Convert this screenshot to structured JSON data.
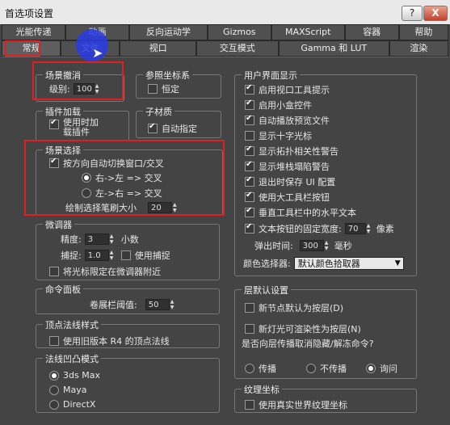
{
  "window": {
    "title": "首选项设置",
    "help_glyph": "?",
    "close_glyph": "X"
  },
  "tabs_row1": [
    "光能传递",
    "动画",
    "反向运动学",
    "Gizmos",
    "MAXScript",
    "容器",
    "帮助"
  ],
  "tabs_row2": [
    "常规",
    "文件",
    "视口",
    "交互模式",
    "Gamma 和 LUT",
    "渲染"
  ],
  "scene_undo": {
    "title": "场景撤消",
    "levels_label": "级别:",
    "levels_value": "100"
  },
  "ref_coord": {
    "title": "参照坐标系",
    "constant_label": "恒定"
  },
  "plugin_load": {
    "title": "插件加载",
    "load_line1": "使用时加",
    "load_line2": "载插件"
  },
  "sub_material": {
    "title": "子材质",
    "auto_assign": "自动指定"
  },
  "scene_select": {
    "title": "场景选择",
    "auto_switch": "按方向自动切换窗口/交叉",
    "rtl": "右->左 => 交叉",
    "ltr": "左->右 => 交叉",
    "brush_size_label": "绘制选择笔刷大小",
    "brush_size_value": "20"
  },
  "spinners": {
    "title": "微调器",
    "precision_label": "精度:",
    "precision_value": "3",
    "precision_unit": "小数",
    "snap_label": "捕捉:",
    "snap_value": "1.0",
    "use_snap": "使用捕捉",
    "wrap_cursor": "将光标限定在微调器附近"
  },
  "command_panel": {
    "title": "命令面板",
    "rollout_label": "卷展栏阈值:",
    "rollout_value": "50"
  },
  "vertex_normal": {
    "title": "顶点法线样式",
    "legacy": "使用旧版本 R4 的顶点法线"
  },
  "bump_mode": {
    "title": "法线凹凸模式",
    "options": [
      "3ds Max",
      "Maya",
      "DirectX"
    ]
  },
  "ui_display": {
    "title": "用户界面显示",
    "items": [
      "启用视口工具提示",
      "启用小盒控件",
      "自动播放预览文件",
      "显示十字光标",
      "显示拓扑相关性警告",
      "显示堆栈塌陷警告",
      "退出时保存 UI 配置",
      "使用大工具栏按钮",
      "垂直工具栏中的水平文本"
    ],
    "fixed_width_label": "文本按钮的固定宽度:",
    "fixed_width_value": "70",
    "fixed_width_unit": "像素",
    "flyout_label": "弹出时间:",
    "flyout_value": "300",
    "flyout_unit": "毫秒",
    "color_picker_label": "颜色选择器:",
    "color_picker_value": "默认颜色拾取器"
  },
  "layer_defaults": {
    "title": "层默认设置",
    "new_nodes": "新节点默认为按层(D)",
    "new_lights": "新灯光可渲染性为按层(N)",
    "propagate_question": "是否向层传播取消隐藏/解冻命令?",
    "options": [
      "传播",
      "不传播",
      "询问"
    ]
  },
  "texture_coords": {
    "title": "纹理坐标",
    "real_world": "使用真实世界纹理坐标"
  }
}
